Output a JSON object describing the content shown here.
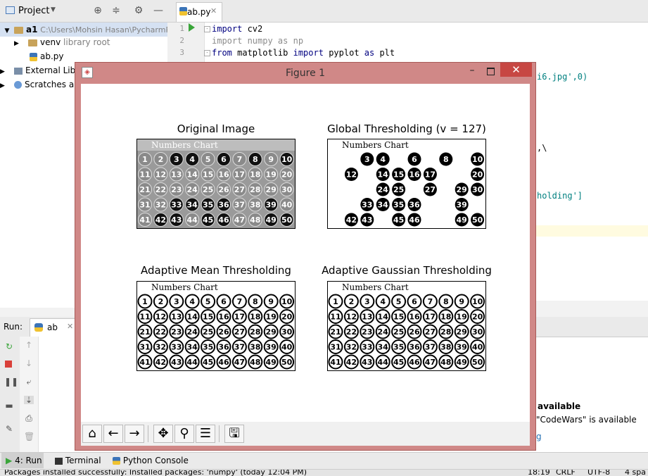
{
  "project_panel": {
    "title": "Project",
    "tree": {
      "root_name": "a1",
      "root_path": "C:\\Users\\Mohsin Hasan\\PycharmP",
      "venv_name": "venv",
      "venv_hint": "library root",
      "file_name": "ab.py",
      "external_libs": "External Libra",
      "scratches": "Scratches and"
    }
  },
  "editor": {
    "tab_label": "ab.py",
    "line_numbers": [
      "1",
      "2",
      "3"
    ],
    "code": {
      "line1_kw": "import",
      "line1_rest": " cv2",
      "line2": "import numpy as np",
      "line3_kw1": "from",
      "line3_mid": " matplotlib ",
      "line3_kw2": "import",
      "line3_mid2": " pyplot ",
      "line3_kw3": "as",
      "line3_end": " plt",
      "frag_imread": "i6.jpg',0)",
      "frag_backslash": ",\\",
      "frag_holding": "holding']"
    }
  },
  "figure_window": {
    "title": "Figure 1",
    "subplots": [
      {
        "title": "Original Image",
        "header": "Numbers Chart"
      },
      {
        "title": "Global Thresholding (v = 127)",
        "header": "Numbers Chart"
      },
      {
        "title": "Adaptive Mean Thresholding",
        "header": "Numbers Chart"
      },
      {
        "title": "Adaptive Gaussian Thresholding",
        "header": "Numbers Chart"
      }
    ],
    "numbers": [
      [
        "1",
        "2",
        "3",
        "4",
        "5",
        "6",
        "7",
        "8",
        "9",
        "10"
      ],
      [
        "11",
        "12",
        "13",
        "14",
        "15",
        "16",
        "17",
        "18",
        "19",
        "20"
      ],
      [
        "21",
        "22",
        "23",
        "24",
        "25",
        "26",
        "27",
        "28",
        "29",
        "30"
      ],
      [
        "31",
        "32",
        "33",
        "34",
        "35",
        "36",
        "37",
        "38",
        "39",
        "40"
      ],
      [
        "41",
        "42",
        "43",
        "44",
        "45",
        "46",
        "47",
        "48",
        "49",
        "50"
      ]
    ],
    "global_visible": [
      "3",
      "4",
      "6",
      "8",
      "10",
      "12",
      "14",
      "15",
      "16",
      "17",
      "20",
      "24",
      "25",
      "27",
      "29",
      "30",
      "33",
      "34",
      "35",
      "36",
      "39",
      "42",
      "43",
      "45",
      "46",
      "49",
      "50"
    ],
    "toolbar": [
      "home-icon",
      "back-icon",
      "forward-icon",
      "pan-icon",
      "zoom-icon",
      "configure-icon",
      "save-icon"
    ]
  },
  "run_panel": {
    "label": "Run:",
    "config": "ab"
  },
  "notifications": {
    "title": "available",
    "message": "\"CodeWars\" is available",
    "link": "g"
  },
  "bottom_tabs": {
    "run": "4: Run",
    "terminal": "Terminal",
    "console": "Python Console"
  },
  "status_bar": {
    "message": "Packages installed successfully: Installed packages: 'numpy' (today 12:04 PM)",
    "position": "18:19",
    "line_sep": "CRLF",
    "encoding": "UTF-8",
    "indent": "4 spa"
  },
  "colors": {
    "figure_frame": "#d08887",
    "close_button": "#c74743",
    "keyword": "#000080",
    "string": "#008080"
  }
}
